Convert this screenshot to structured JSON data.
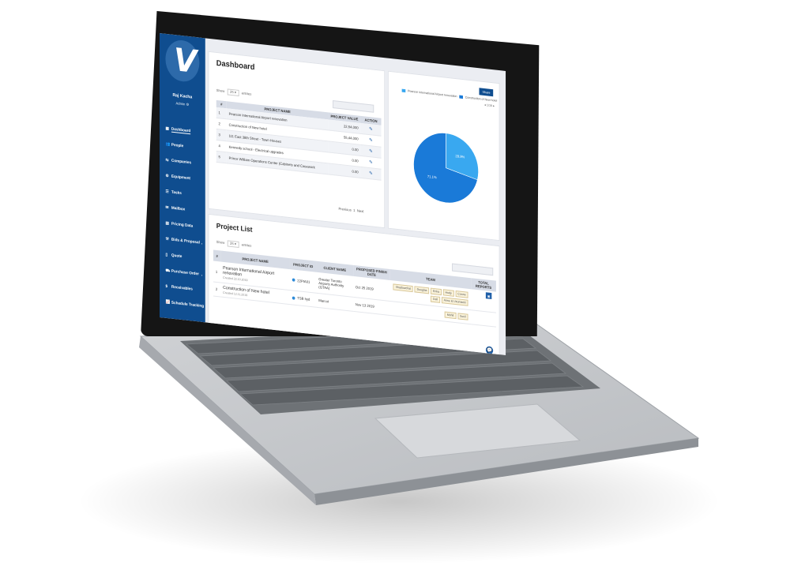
{
  "colors": {
    "brand": "#0f4d8f",
    "pie_dark": "#1a7ad8",
    "pie_light": "#39a8f0"
  },
  "sidebar": {
    "user_name": "Raj Kacha",
    "user_role": "Admin",
    "items": [
      {
        "label": "Dashboard",
        "icon": "grid-icon"
      },
      {
        "label": "People",
        "icon": "people-icon"
      },
      {
        "label": "Companies",
        "icon": "handshake-icon"
      },
      {
        "label": "Equipment",
        "icon": "gear-icon"
      },
      {
        "label": "Tasks",
        "icon": "list-icon"
      },
      {
        "label": "Mailbox",
        "icon": "mail-icon"
      },
      {
        "label": "Pricing Data",
        "icon": "document-icon"
      },
      {
        "label": "Bids & Proposal",
        "icon": "gavel-icon"
      },
      {
        "label": "Quote",
        "icon": "file-icon"
      },
      {
        "label": "Purchase Order",
        "icon": "cart-icon"
      },
      {
        "label": "Receivables",
        "icon": "dollar-icon"
      },
      {
        "label": "Schedule Tracking",
        "icon": "chart-icon"
      }
    ]
  },
  "dashboard": {
    "title": "Dashboard",
    "show_label": "Show",
    "show_value": "25",
    "entries_label": "entries",
    "headers": [
      "#",
      "PROJECT NAME",
      "PROJECT VALUE",
      "ACTION"
    ],
    "rows": [
      {
        "num": "1",
        "name": "Pearson International Airport renovation",
        "value": "22,54,000"
      },
      {
        "num": "2",
        "name": "Construction of New hotel",
        "value": "55,44,000"
      },
      {
        "num": "3",
        "name": "111 East 38th Street - Town Houses",
        "value": "0.00"
      },
      {
        "num": "4",
        "name": "Kennedy school - Electrical upgrades",
        "value": "0.00"
      },
      {
        "num": "5",
        "name": "Prince William Operations Center (Cabinets and Casework",
        "value": "0.00"
      }
    ],
    "pager": {
      "previous": "Previous",
      "page": "1",
      "next": "Next"
    }
  },
  "pie": {
    "share_label": "Share",
    "legend": [
      "Pearson International Airport renovation",
      "Construction of New hotel"
    ],
    "page_indicator": "1/16",
    "chart_data": {
      "type": "pie",
      "labels": [
        "Pearson International Airport renovation",
        "Construction of New hotel"
      ],
      "values": [
        71.1,
        28.9
      ],
      "slice_labels": [
        "71.1%",
        "28.9%"
      ]
    }
  },
  "project_list": {
    "title": "Project List",
    "show_label": "Show",
    "show_value": "25",
    "entries_label": "entries",
    "headers": [
      "#",
      "PROJECT NAME",
      "PROJECT ID",
      "CLIENT NAME",
      "PROPOSED FINISH DATE",
      "TEAM",
      "TOTAL REPORTS"
    ],
    "rows": [
      {
        "num": "1",
        "name": "Pearson International Airport renovation",
        "created": "Created 22.10.2019",
        "id": "22PIA01",
        "client": "Greater Toronto Airports Authority (GTAA)",
        "date": "Oct 25 2019",
        "team": [
          "Shadowchat",
          "Douglas",
          "Enka",
          "Hody",
          "Conne",
          "Dell",
          "Anne & Uzumacki"
        ]
      },
      {
        "num": "2",
        "name": "Construction of New hotel",
        "created": "Created 12.11.2019",
        "id": "TSB hyd",
        "client": "Marcot",
        "date": "Nov 13 2019",
        "team": [
          "Mohit",
          "Sunil"
        ]
      }
    ]
  }
}
